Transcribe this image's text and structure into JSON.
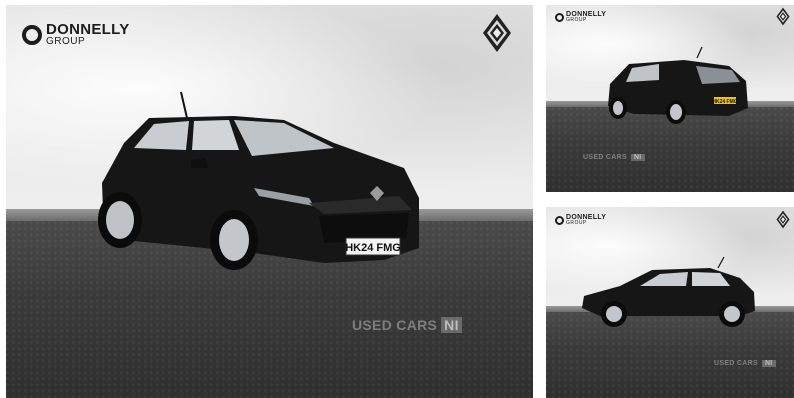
{
  "gallery": {
    "dealer": {
      "brand": "DONNELLY",
      "sub": "GROUP"
    },
    "watermark": {
      "text": "USED CARS",
      "badge": "NI"
    },
    "main_photo": {
      "plate": "HK24 FMG"
    },
    "thumb_top": {
      "plate": "HK24 FMG"
    },
    "car_color": "#161616",
    "icons": {
      "dealer_logo": "donnelly-o-logo",
      "maker_logo": "renault-diamond-logo"
    }
  }
}
